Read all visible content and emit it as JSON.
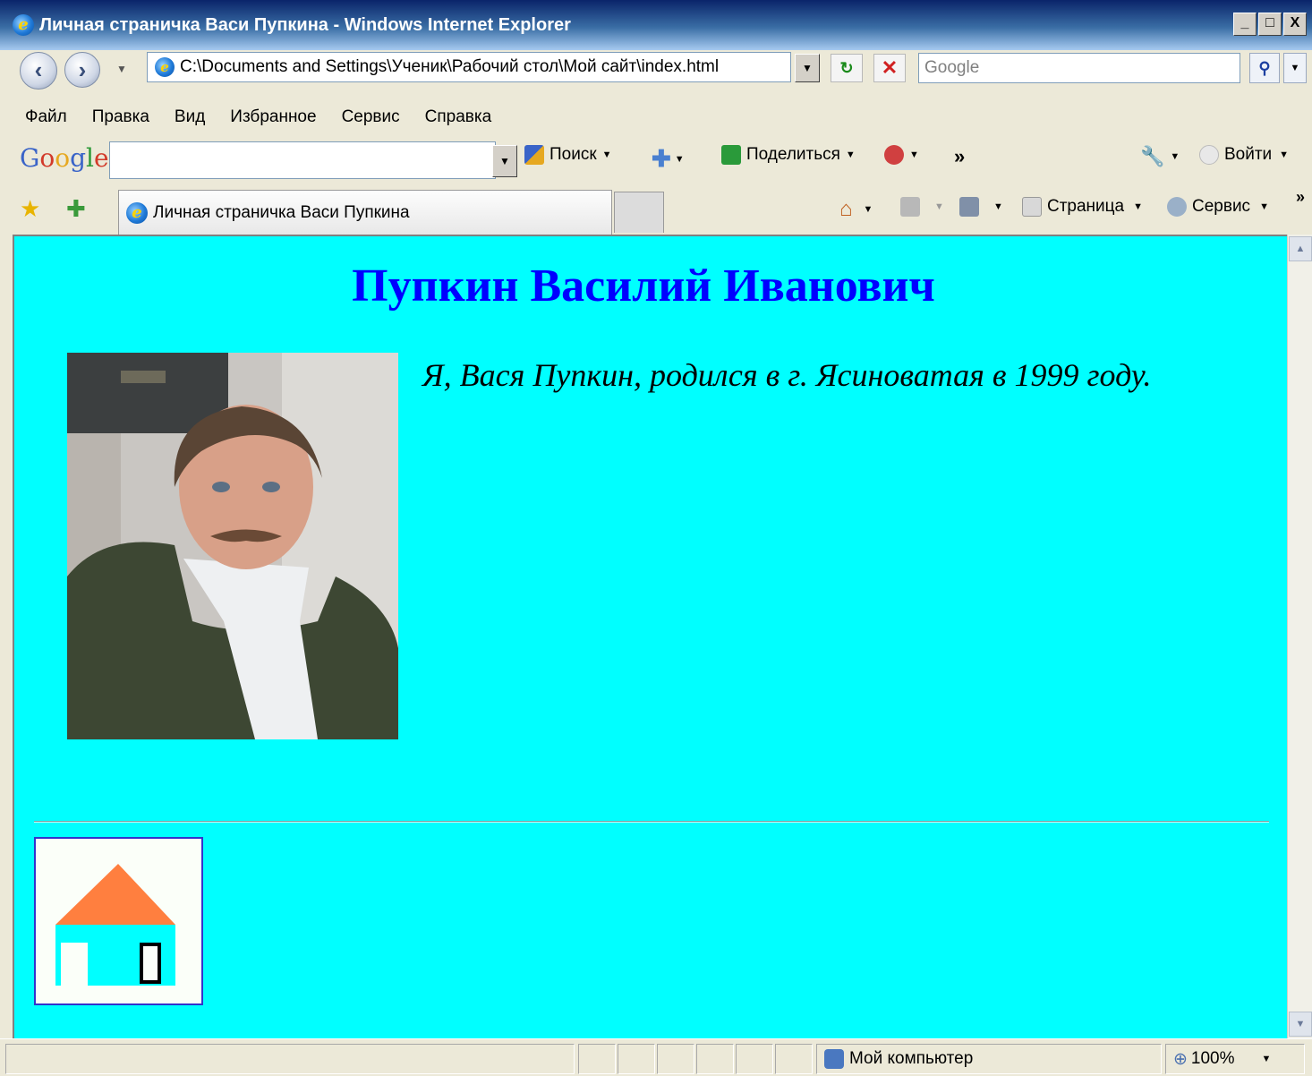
{
  "window": {
    "title": "Личная страничка Васи Пупкина - Windows Internet Explorer",
    "minimize": "_",
    "maximize": "□",
    "close": "X"
  },
  "address_bar": {
    "url": "C:\\Documents and Settings\\Ученик\\Рабочий стол\\Мой сайт\\index.html",
    "search_placeholder": "Google"
  },
  "menu": [
    "Файл",
    "Правка",
    "Вид",
    "Избранное",
    "Сервис",
    "Справка"
  ],
  "google_toolbar": {
    "logo": "Google",
    "search_label": "Поиск",
    "share_label": "Поделиться",
    "more": "»",
    "signin_label": "Войти"
  },
  "tab": {
    "label": "Личная страничка Васи Пупкина"
  },
  "command_bar": {
    "page_label": "Страница",
    "tools_label": "Сервис",
    "more": "»"
  },
  "page": {
    "heading": "Пупкин Василий Иванович",
    "intro": "Я, Вася Пупкин, родился в г. Ясиноватая в 1999 году.",
    "colors": {
      "background": "#00ffff",
      "heading": "#0000ff",
      "roof": "#ff7f3f",
      "house": "#00ffff"
    }
  },
  "status_bar": {
    "zone": "Мой компьютер",
    "zoom": "100%"
  }
}
